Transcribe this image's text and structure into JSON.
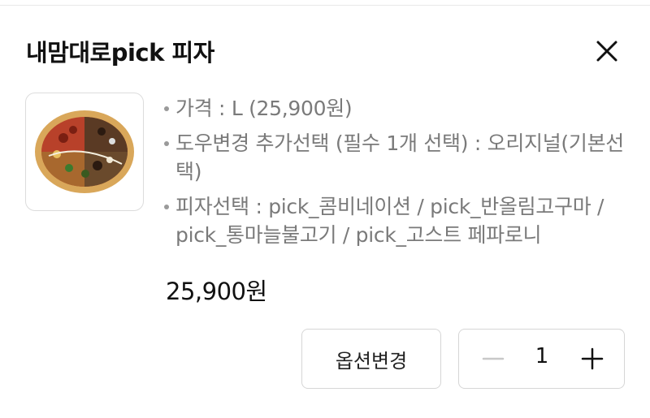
{
  "product": {
    "title": "내맘대로pick 피자",
    "image_alt": "pizza-image"
  },
  "options": [
    "가격 : L (25,900원)",
    "도우변경 추가선택 (필수 1개 선택) : 오리지널(기본선택)",
    "피자선택 : pick_콤비네이션 / pick_반올림고구마 / pick_통마늘불고기 / pick_고스트 페파로니"
  ],
  "price": "25,900원",
  "buttons": {
    "change_option_label": "옵션변경"
  },
  "quantity": {
    "value": "1",
    "minus_enabled": false
  },
  "icons": {
    "close": "close-icon",
    "minus": "minus-icon",
    "plus": "plus-icon"
  },
  "colors": {
    "text_primary": "#111111",
    "text_secondary": "#7a7a7a",
    "border": "#d6d6d6",
    "disabled_icon": "#c8c8c8"
  }
}
